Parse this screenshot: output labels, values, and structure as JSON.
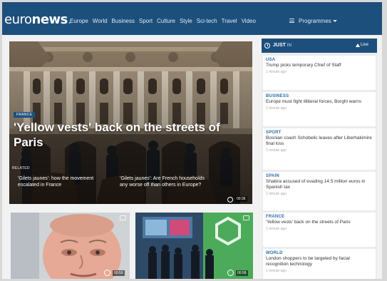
{
  "header": {
    "logo_main": "euro",
    "logo_bold": "news",
    "logo_dot": ".",
    "nav": [
      "Europe",
      "World",
      "Business",
      "Sport",
      "Culture",
      "Style",
      "Sci-tech",
      "Travel",
      "Video"
    ],
    "programmes_label": "Programmes"
  },
  "hero": {
    "tag": "FRANCE",
    "title": "'Yellow vests' back on the streets of Paris",
    "related_label": "RELATED",
    "related": [
      "'Gilets jaunes': how the movement escalated in France",
      "'Gilets jaunes': Are French households any worse off than others in Europe?"
    ],
    "duration": "00:36"
  },
  "cards": [
    {
      "duration": "00:59"
    },
    {
      "duration": "00:58"
    }
  ],
  "just_in": {
    "label": "JUST",
    "label_in": "IN",
    "live_label": "Live",
    "items": [
      {
        "category": "USA",
        "headline": "Trump picks temporary Chief of Staff",
        "time": "1 minute ago"
      },
      {
        "category": "BUSINESS",
        "headline": "Europe must fight illiberal forces, Borghi warns",
        "time": "1 minute ago"
      },
      {
        "category": "SPORT",
        "headline": "Bosnian coach Schobelic leaves after Liberhakimire final loss",
        "time": "1 minute ago"
      },
      {
        "category": "SPAIN",
        "headline": "Shakira accused of evading 14.5 million euros in Spanish tax",
        "time": "1 minute ago"
      },
      {
        "category": "FRANCE",
        "headline": "'Yellow vests' back on the streets of Paris",
        "time": "1 minute ago"
      },
      {
        "category": "WORLD",
        "headline": "London shoppers to be targeted by facial recognition technology",
        "time": "1 minute ago"
      }
    ]
  }
}
